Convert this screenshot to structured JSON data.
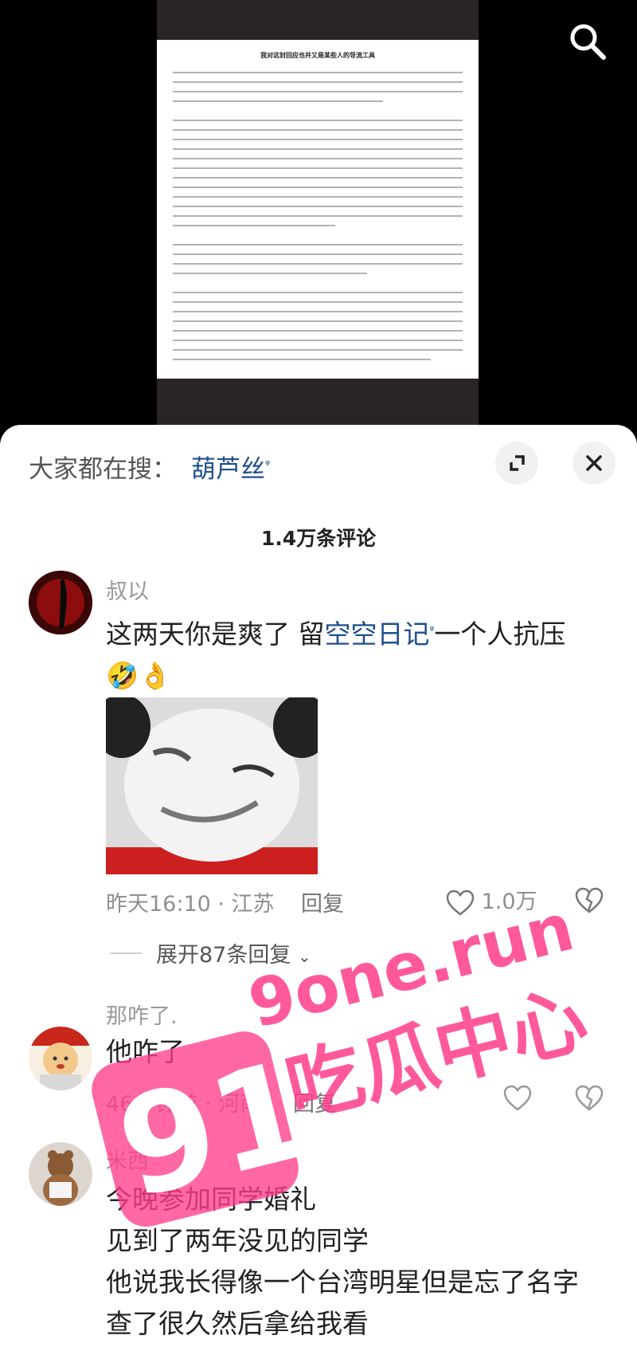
{
  "video": {
    "doc_title": "我对这封回应也并又是某些人的导流工具",
    "search_icon": "search-icon"
  },
  "sheet": {
    "hot_prefix": "大家都在搜：",
    "hot_keyword": "葫芦丝",
    "comment_count": "1.4万条评论"
  },
  "comments": [
    {
      "username": "叔以",
      "text_prefix": "这两天你是爽了 留",
      "link": "空空日记",
      "text_suffix": "一个人抗压",
      "emojis": "🤣👌",
      "time_location": "昨天16:10 · 江苏",
      "reply": "回复",
      "likes": "1.0万",
      "expand": "展开87条回复"
    },
    {
      "username": "那咋了.",
      "text": "他咋了",
      "time_location": "46分钟前 · 河南",
      "reply": "回复"
    },
    {
      "username": "米西",
      "lines": [
        "今晚参加同学婚礼",
        "见到了两年没见的同学",
        "他说我长得像一个台湾明星但是忘了名字",
        "查了很久然后拿给我看"
      ]
    }
  ],
  "watermark": {
    "number": "91",
    "domain": "9one.run",
    "caption": "吃瓜中心",
    "color": "#ff3d8b"
  }
}
